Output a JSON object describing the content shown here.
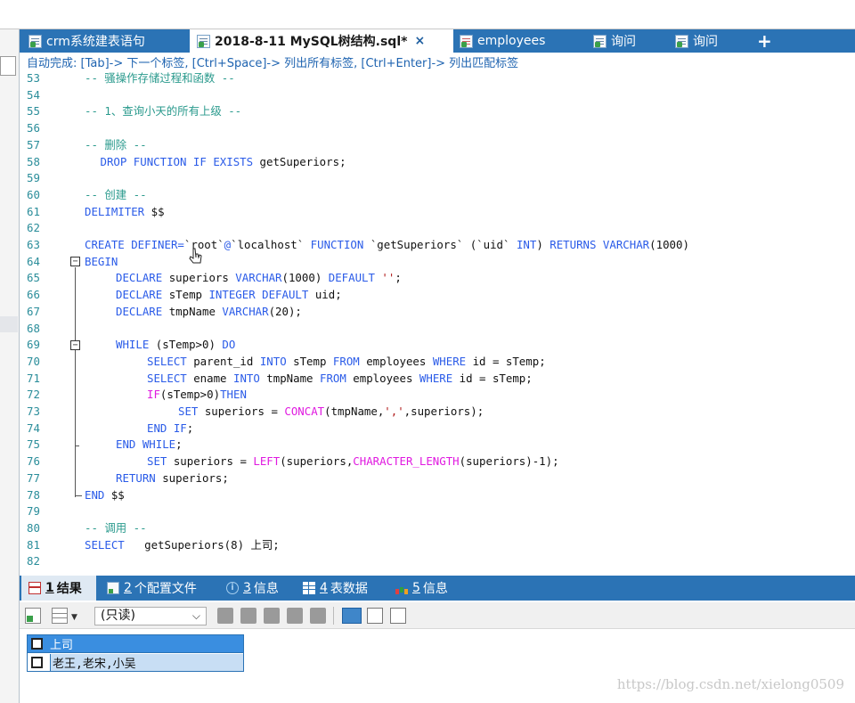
{
  "tabs": [
    {
      "label": "crm系统建表语句",
      "icon": "query-file-icon",
      "active": false
    },
    {
      "label": "2018-8-11 MySQL树结构.sql*",
      "icon": "query-file-icon",
      "active": true,
      "close": "×"
    },
    {
      "label": "employees",
      "icon": "table-icon",
      "active": false
    },
    {
      "label": "询问",
      "icon": "query-file-icon",
      "active": false
    },
    {
      "label": "询问",
      "icon": "query-file-icon",
      "active": false
    },
    {
      "label": "+",
      "icon": "",
      "active": false
    }
  ],
  "hint": "自动完成: [Tab]-> 下一个标签, [Ctrl+Space]-> 列出所有标签, [Ctrl+Enter]-> 列出匹配标签",
  "editor": {
    "lines": [
      {
        "n": "53",
        "indent": 0,
        "tokens": [
          [
            "cmt",
            "-- 骚操作存储过程和函数 --"
          ]
        ]
      },
      {
        "n": "54",
        "indent": 0,
        "tokens": []
      },
      {
        "n": "55",
        "indent": 0,
        "tokens": [
          [
            "cmt",
            "-- 1、查询小天的所有上级 --"
          ]
        ]
      },
      {
        "n": "56",
        "indent": 0,
        "tokens": []
      },
      {
        "n": "57",
        "indent": 0,
        "tokens": [
          [
            "cmt",
            "-- 删除 --"
          ]
        ]
      },
      {
        "n": "58",
        "indent": 1,
        "tokens": [
          [
            "kw",
            "DROP FUNCTION IF EXISTS "
          ],
          [
            "id",
            "getSuperiors;"
          ]
        ]
      },
      {
        "n": "59",
        "indent": 0,
        "tokens": []
      },
      {
        "n": "60",
        "indent": 0,
        "tokens": [
          [
            "cmt",
            "-- 创建 --"
          ]
        ]
      },
      {
        "n": "61",
        "indent": 0,
        "tokens": [
          [
            "kw",
            "DELIMITER "
          ],
          [
            "id",
            "$$"
          ]
        ]
      },
      {
        "n": "62",
        "indent": 0,
        "tokens": []
      },
      {
        "n": "63",
        "indent": 0,
        "tokens": [
          [
            "kw",
            "CREATE DEFINER="
          ],
          [
            "id",
            "`root`"
          ],
          [
            "kw",
            "@"
          ],
          [
            "id",
            "`localhost`"
          ],
          [
            "kw",
            " FUNCTION "
          ],
          [
            "id",
            "`getSuperiors`"
          ],
          [
            "tx",
            " ("
          ],
          [
            "id",
            "`uid`"
          ],
          [
            "kw",
            " INT"
          ],
          [
            "tx",
            ") "
          ],
          [
            "kw",
            "RETURNS VARCHAR"
          ],
          [
            "tx",
            "(1000)"
          ]
        ]
      },
      {
        "n": "64",
        "indent": 0,
        "tokens": [
          [
            "kw",
            "BEGIN"
          ]
        ]
      },
      {
        "n": "65",
        "indent": 2,
        "tokens": [
          [
            "kw",
            "DECLARE "
          ],
          [
            "id",
            "superiors "
          ],
          [
            "kw",
            "VARCHAR"
          ],
          [
            "tx",
            "(1000) "
          ],
          [
            "kw",
            "DEFAULT "
          ],
          [
            "str",
            "''"
          ],
          [
            "tx",
            ";"
          ]
        ]
      },
      {
        "n": "66",
        "indent": 2,
        "tokens": [
          [
            "kw",
            "DECLARE "
          ],
          [
            "id",
            "sTemp "
          ],
          [
            "kw",
            "INTEGER DEFAULT "
          ],
          [
            "id",
            "uid;"
          ]
        ]
      },
      {
        "n": "67",
        "indent": 2,
        "tokens": [
          [
            "kw",
            "DECLARE "
          ],
          [
            "id",
            "tmpName "
          ],
          [
            "kw",
            "VARCHAR"
          ],
          [
            "tx",
            "(20);"
          ]
        ]
      },
      {
        "n": "68",
        "indent": 0,
        "tokens": []
      },
      {
        "n": "69",
        "indent": 2,
        "tokens": [
          [
            "kw",
            "WHILE "
          ],
          [
            "tx",
            "(sTemp>0) "
          ],
          [
            "kw",
            "DO"
          ]
        ]
      },
      {
        "n": "70",
        "indent": 4,
        "tokens": [
          [
            "kw",
            "SELECT "
          ],
          [
            "id",
            "parent_id "
          ],
          [
            "kw",
            "INTO "
          ],
          [
            "id",
            "sTemp "
          ],
          [
            "kw",
            "FROM "
          ],
          [
            "id",
            "employees "
          ],
          [
            "kw",
            "WHERE "
          ],
          [
            "id",
            "id = sTemp;"
          ]
        ]
      },
      {
        "n": "71",
        "indent": 4,
        "tokens": [
          [
            "kw",
            "SELECT "
          ],
          [
            "id",
            "ename "
          ],
          [
            "kw",
            "INTO "
          ],
          [
            "id",
            "tmpName "
          ],
          [
            "kw",
            "FROM "
          ],
          [
            "id",
            "employees "
          ],
          [
            "kw",
            "WHERE "
          ],
          [
            "id",
            "id = sTemp;"
          ]
        ]
      },
      {
        "n": "72",
        "indent": 4,
        "tokens": [
          [
            "fn",
            "IF"
          ],
          [
            "tx",
            "(sTemp>0)"
          ],
          [
            "kw",
            "THEN"
          ]
        ]
      },
      {
        "n": "73",
        "indent": 6,
        "tokens": [
          [
            "kw",
            "SET "
          ],
          [
            "id",
            "superiors = "
          ],
          [
            "fn",
            "CONCAT"
          ],
          [
            "tx",
            "(tmpName,"
          ],
          [
            "str",
            "','"
          ],
          [
            "tx",
            ",superiors);"
          ]
        ]
      },
      {
        "n": "74",
        "indent": 4,
        "tokens": [
          [
            "kw",
            "END IF"
          ],
          [
            "tx",
            ";"
          ]
        ]
      },
      {
        "n": "75",
        "indent": 2,
        "tokens": [
          [
            "kw",
            "END WHILE"
          ],
          [
            "tx",
            ";"
          ]
        ]
      },
      {
        "n": "76",
        "indent": 4,
        "tokens": [
          [
            "kw",
            "SET "
          ],
          [
            "id",
            "superiors = "
          ],
          [
            "fn",
            "LEFT"
          ],
          [
            "tx",
            "(superiors,"
          ],
          [
            "fn",
            "CHARACTER_LENGTH"
          ],
          [
            "tx",
            "(superiors)-1);"
          ]
        ]
      },
      {
        "n": "77",
        "indent": 2,
        "tokens": [
          [
            "kw",
            "RETURN "
          ],
          [
            "id",
            "superiors;"
          ]
        ]
      },
      {
        "n": "78",
        "indent": 0,
        "tokens": [
          [
            "kw",
            "END "
          ],
          [
            "id",
            "$$"
          ]
        ]
      },
      {
        "n": "79",
        "indent": 0,
        "tokens": []
      },
      {
        "n": "80",
        "indent": 0,
        "tokens": [
          [
            "cmt",
            "-- 调用 --"
          ]
        ]
      },
      {
        "n": "81",
        "indent": 0,
        "tokens": [
          [
            "kw",
            "SELECT   "
          ],
          [
            "id",
            "getSuperiors(8) 上司;"
          ]
        ]
      },
      {
        "n": "82",
        "indent": 0,
        "tokens": []
      }
    ]
  },
  "bottom_tabs": [
    {
      "num": "1",
      "label": "结果",
      "icon": "result-icon",
      "active": true
    },
    {
      "num": "2",
      "label": "个配置文件",
      "icon": "profile-icon",
      "active": false
    },
    {
      "num": "3",
      "label": "信息",
      "icon": "info-icon",
      "active": false
    },
    {
      "num": "4",
      "label": "表数据",
      "icon": "table-data-icon",
      "active": false
    },
    {
      "num": "5",
      "label": "信息",
      "icon": "chart-icon",
      "active": false
    }
  ],
  "toolbar": {
    "mode_select": "(只读)"
  },
  "result": {
    "columns": [
      "上司"
    ],
    "rows": [
      [
        "老王,老宋,小吴"
      ]
    ]
  },
  "watermark": "https://blog.csdn.net/xielong0509",
  "colors": {
    "tabbar": "#2b73b5",
    "keyword": "#2a5be8",
    "function": "#e01ae0",
    "comment": "#2a9a8d",
    "string": "#b01a1a"
  }
}
